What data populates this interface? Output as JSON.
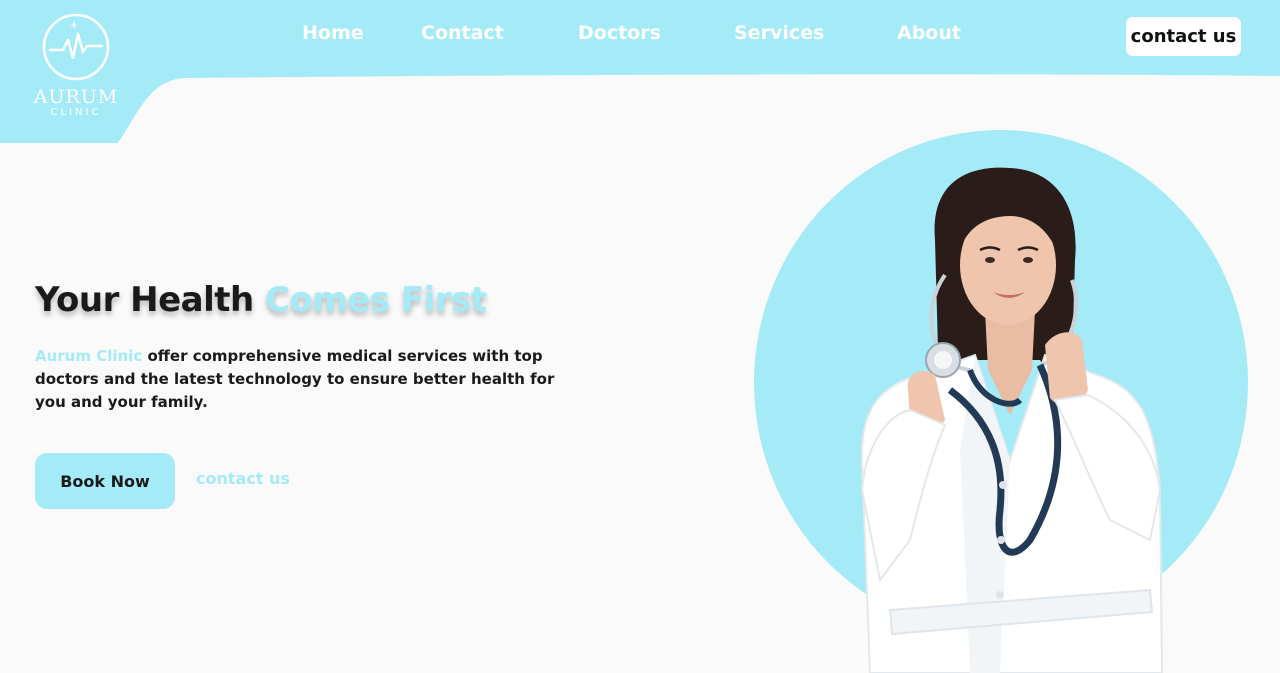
{
  "brand": {
    "name": "AURUM",
    "sub": "CLINIC"
  },
  "nav": {
    "items": [
      {
        "label": "Home"
      },
      {
        "label": "Contact"
      },
      {
        "label": "Doctors"
      },
      {
        "label": "Services"
      },
      {
        "label": "About"
      }
    ],
    "cta_label": "contact us"
  },
  "hero": {
    "title_main": "Your Health ",
    "title_accent": "Comes First",
    "desc_accent": "Aurum Clinic",
    "desc_rest": " offer comprehensive medical services with top doctors and the latest technology to ensure better health for you and your family.",
    "primary_button": "Book Now",
    "secondary_link": "contact us"
  },
  "colors": {
    "accent": "#a4eaf7",
    "background": "#fafafa",
    "text": "#1a1a1a"
  },
  "icons": [
    "heartbeat-logo-icon",
    "doctor-illustration"
  ]
}
